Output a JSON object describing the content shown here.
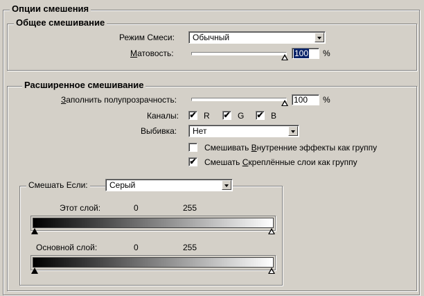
{
  "main_group": {
    "title": "Опции смешения"
  },
  "general": {
    "title": "Общее смешивание",
    "mode_label": "Режим Смеси:",
    "mode_value": "Обычный",
    "opacity_label": "Матовость:",
    "opacity_value": "100",
    "opacity_unit": "%",
    "opacity_level": 1.0
  },
  "advanced": {
    "title": "Расширенное смешивание",
    "fill_label": "Заполнить полупрозрачность:",
    "fill_value": "100",
    "fill_unit": "%",
    "fill_level": 1.0,
    "channels_label": "Каналы:",
    "channels": [
      {
        "label": "R",
        "checked": true
      },
      {
        "label": "G",
        "checked": true
      },
      {
        "label": "B",
        "checked": true
      }
    ],
    "knockout_label": "Выбивка:",
    "knockout_value": "Нет",
    "checks": [
      {
        "label": "Смешивать Внутренние эффекты как группу",
        "checked": false
      },
      {
        "label": "Смешать Скреплённые слои как группу",
        "checked": true
      }
    ],
    "blend_if": {
      "label": "Смешать Если:",
      "value": "Серый",
      "this_layer_label": "Этот слой:",
      "this_low": "0",
      "this_high": "255",
      "underlying_label": "Основной слой:",
      "under_low": "0",
      "under_high": "255"
    }
  },
  "check_glyph": "✔"
}
